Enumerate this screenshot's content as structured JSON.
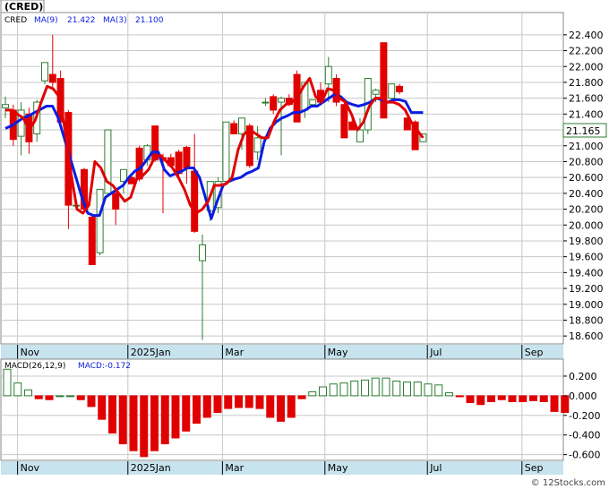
{
  "title": "(CRED)",
  "price_legend": {
    "symbol": "CRED",
    "ma9_label": "MA(9)",
    "ma9_value": "21.422",
    "ma3_label": "MA(3)",
    "ma3_value": "21.100"
  },
  "macd_legend": {
    "label": "MACD(26,12,9)",
    "value_label": "MACD:-0.172"
  },
  "current_price": "21.165",
  "watermark": "© 12Stocks.com",
  "colors": {
    "up": "#2e7d32",
    "down": "#e00000",
    "ma9": "#0a1ee0",
    "ma3": "#e00000",
    "axis_band": "#c6e3ee",
    "grid": "#c8c8c8",
    "price_tag_border": "#2e7d32"
  },
  "chart_data": [
    {
      "type": "candlestick",
      "title": "(CRED)",
      "ylim": [
        18.5,
        22.5
      ],
      "y_ticks": [
        "22.400",
        "22.200",
        "22.000",
        "21.800",
        "21.600",
        "21.400",
        "21.200",
        "21.000",
        "20.800",
        "20.600",
        "20.400",
        "20.200",
        "20.000",
        "19.800",
        "19.600",
        "19.400",
        "19.200",
        "19.000",
        "18.800",
        "18.600"
      ],
      "x_labels": [
        {
          "label": "Nov",
          "index": 2
        },
        {
          "label": "2025Jan",
          "index": 16
        },
        {
          "label": "Mar",
          "index": 28
        },
        {
          "label": "May",
          "index": 41
        },
        {
          "label": "Jul",
          "index": 54
        },
        {
          "label": "Sep",
          "index": 66
        }
      ],
      "candles": [
        {
          "o": 21.48,
          "h": 21.62,
          "l": 21.35,
          "c": 21.52
        },
        {
          "o": 21.45,
          "h": 21.52,
          "l": 21.0,
          "c": 21.08
        },
        {
          "o": 21.12,
          "h": 21.55,
          "l": 20.88,
          "c": 21.45
        },
        {
          "o": 21.4,
          "h": 21.48,
          "l": 20.9,
          "c": 21.05
        },
        {
          "o": 21.15,
          "h": 21.58,
          "l": 21.05,
          "c": 21.55
        },
        {
          "o": 21.82,
          "h": 22.05,
          "l": 21.78,
          "c": 22.05
        },
        {
          "o": 21.9,
          "h": 22.4,
          "l": 21.7,
          "c": 21.8
        },
        {
          "o": 21.85,
          "h": 21.95,
          "l": 21.25,
          "c": 21.3
        },
        {
          "o": 21.42,
          "h": 21.45,
          "l": 19.95,
          "c": 20.25
        },
        {
          "o": 20.25,
          "h": 20.3,
          "l": 20.2,
          "c": 20.25
        },
        {
          "o": 20.7,
          "h": 20.72,
          "l": 20.2,
          "c": 20.2
        },
        {
          "o": 20.1,
          "h": 20.12,
          "l": 19.5,
          "c": 19.5
        },
        {
          "o": 19.65,
          "h": 20.45,
          "l": 19.62,
          "c": 20.45
        },
        {
          "o": 20.4,
          "h": 21.2,
          "l": 20.35,
          "c": 21.2
        },
        {
          "o": 20.4,
          "h": 20.45,
          "l": 20.0,
          "c": 20.2
        },
        {
          "o": 20.55,
          "h": 20.7,
          "l": 20.4,
          "c": 20.7
        },
        {
          "o": 20.6,
          "h": 20.65,
          "l": 20.52,
          "c": 20.52
        },
        {
          "o": 20.97,
          "h": 21.0,
          "l": 20.55,
          "c": 20.58
        },
        {
          "o": 20.82,
          "h": 21.02,
          "l": 20.75,
          "c": 21.0
        },
        {
          "o": 21.25,
          "h": 21.25,
          "l": 20.8,
          "c": 20.82
        },
        {
          "o": 20.85,
          "h": 20.9,
          "l": 20.15,
          "c": 20.82
        },
        {
          "o": 20.85,
          "h": 20.9,
          "l": 20.75,
          "c": 20.75
        },
        {
          "o": 20.92,
          "h": 20.95,
          "l": 20.6,
          "c": 20.65
        },
        {
          "o": 20.98,
          "h": 21.0,
          "l": 20.52,
          "c": 20.72
        },
        {
          "o": 20.68,
          "h": 21.15,
          "l": 19.9,
          "c": 19.92
        },
        {
          "o": 19.55,
          "h": 19.88,
          "l": 18.55,
          "c": 19.75
        },
        {
          "o": 20.18,
          "h": 20.55,
          "l": 20.05,
          "c": 20.55
        },
        {
          "o": 20.22,
          "h": 20.6,
          "l": 20.15,
          "c": 20.55
        },
        {
          "o": 20.55,
          "h": 21.3,
          "l": 20.52,
          "c": 21.3
        },
        {
          "o": 21.28,
          "h": 21.32,
          "l": 21.15,
          "c": 21.15
        },
        {
          "o": 21.15,
          "h": 21.35,
          "l": 20.95,
          "c": 21.35
        },
        {
          "o": 21.25,
          "h": 21.28,
          "l": 20.72,
          "c": 20.75
        },
        {
          "o": 20.92,
          "h": 21.25,
          "l": 20.82,
          "c": 21.1
        },
        {
          "o": 21.55,
          "h": 21.6,
          "l": 21.5,
          "c": 21.55
        },
        {
          "o": 21.62,
          "h": 21.65,
          "l": 21.4,
          "c": 21.45
        },
        {
          "o": 21.55,
          "h": 21.62,
          "l": 20.88,
          "c": 21.6
        },
        {
          "o": 21.6,
          "h": 21.65,
          "l": 21.5,
          "c": 21.52
        },
        {
          "o": 21.9,
          "h": 21.95,
          "l": 21.3,
          "c": 21.3
        },
        {
          "o": 21.45,
          "h": 21.8,
          "l": 21.35,
          "c": 21.8
        },
        {
          "o": 21.52,
          "h": 21.58,
          "l": 21.5,
          "c": 21.58
        },
        {
          "o": 21.7,
          "h": 21.8,
          "l": 21.55,
          "c": 21.55
        },
        {
          "o": 21.78,
          "h": 22.12,
          "l": 21.55,
          "c": 22.0
        },
        {
          "o": 21.85,
          "h": 21.9,
          "l": 21.5,
          "c": 21.55
        },
        {
          "o": 21.52,
          "h": 21.55,
          "l": 21.12,
          "c": 21.1
        },
        {
          "o": 21.3,
          "h": 21.35,
          "l": 21.2,
          "c": 21.2
        },
        {
          "o": 21.05,
          "h": 21.35,
          "l": 21.05,
          "c": 21.2
        },
        {
          "o": 21.2,
          "h": 21.85,
          "l": 21.15,
          "c": 21.85
        },
        {
          "o": 21.65,
          "h": 21.72,
          "l": 21.55,
          "c": 21.7
        },
        {
          "o": 22.3,
          "h": 22.3,
          "l": 21.35,
          "c": 21.35
        },
        {
          "o": 21.6,
          "h": 21.78,
          "l": 21.58,
          "c": 21.78
        },
        {
          "o": 21.75,
          "h": 21.78,
          "l": 21.65,
          "c": 21.68
        },
        {
          "o": 21.35,
          "h": 21.35,
          "l": 21.2,
          "c": 21.2
        },
        {
          "o": 21.3,
          "h": 21.32,
          "l": 20.95,
          "c": 20.95
        },
        {
          "o": 21.05,
          "h": 21.15,
          "l": 21.05,
          "c": 21.15
        }
      ],
      "series": [
        {
          "name": "MA(9)",
          "values": [
            21.22,
            21.25,
            21.3,
            21.35,
            21.38,
            21.42,
            21.46,
            21.5,
            21.5,
            21.35,
            21.1,
            20.85,
            20.6,
            20.35,
            20.15,
            20.12,
            20.12,
            20.35,
            20.4,
            20.45,
            20.5,
            20.6,
            20.68,
            20.72,
            20.82,
            20.92,
            20.92,
            20.7,
            20.62,
            20.65,
            20.68,
            20.72,
            20.72,
            20.6,
            20.35,
            20.08,
            20.3,
            20.5,
            20.55,
            20.58,
            20.6,
            20.65,
            20.68,
            20.72,
            21.05,
            21.22,
            21.3,
            21.35,
            21.38,
            21.42,
            21.42,
            21.45,
            21.5,
            21.5,
            21.55,
            21.6,
            21.65,
            21.62,
            21.55,
            21.52,
            21.5,
            21.52,
            21.55,
            21.6,
            21.58,
            21.55,
            21.58,
            21.58,
            21.56,
            21.42,
            21.42,
            21.42
          ]
        },
        {
          "name": "MA(3)",
          "values": [
            21.45,
            21.45,
            21.4,
            21.35,
            21.2,
            21.32,
            21.55,
            21.75,
            21.72,
            21.62,
            21.2,
            20.65,
            20.2,
            20.15,
            20.25,
            20.8,
            20.72,
            20.55,
            20.5,
            20.4,
            20.3,
            20.35,
            20.58,
            20.62,
            20.7,
            20.85,
            20.88,
            20.8,
            20.72,
            20.6,
            20.45,
            20.25,
            20.15,
            20.2,
            20.3,
            20.5,
            20.5,
            20.52,
            20.6,
            20.95,
            21.15,
            21.2,
            21.15,
            21.1,
            21.1,
            21.3,
            21.45,
            21.52,
            21.55,
            21.62,
            21.75,
            21.85,
            21.62,
            21.55,
            21.72,
            21.7,
            21.6,
            21.55,
            21.4,
            21.2,
            21.3,
            21.5,
            21.6,
            21.6,
            21.55,
            21.55,
            21.52,
            21.45,
            21.3,
            21.2,
            21.1
          ]
        }
      ]
    },
    {
      "type": "bar",
      "title": "MACD(26,12,9)",
      "ylim": [
        -0.64,
        0.3
      ],
      "y_ticks": [
        "0.200",
        "0.000",
        "-0.200",
        "-0.400",
        "-0.600"
      ],
      "values": [
        0.27,
        0.13,
        0.06,
        -0.03,
        -0.04,
        0.0,
        0.0,
        -0.04,
        -0.11,
        -0.24,
        -0.38,
        -0.49,
        -0.56,
        -0.62,
        -0.56,
        -0.49,
        -0.43,
        -0.36,
        -0.28,
        -0.22,
        -0.17,
        -0.13,
        -0.12,
        -0.12,
        -0.13,
        -0.22,
        -0.26,
        -0.22,
        -0.03,
        0.04,
        0.09,
        0.12,
        0.13,
        0.15,
        0.16,
        0.18,
        0.18,
        0.15,
        0.14,
        0.14,
        0.12,
        0.11,
        0.03,
        -0.01,
        -0.07,
        -0.09,
        -0.06,
        -0.04,
        -0.06,
        -0.06,
        -0.05,
        -0.06,
        -0.16,
        -0.17
      ]
    }
  ]
}
